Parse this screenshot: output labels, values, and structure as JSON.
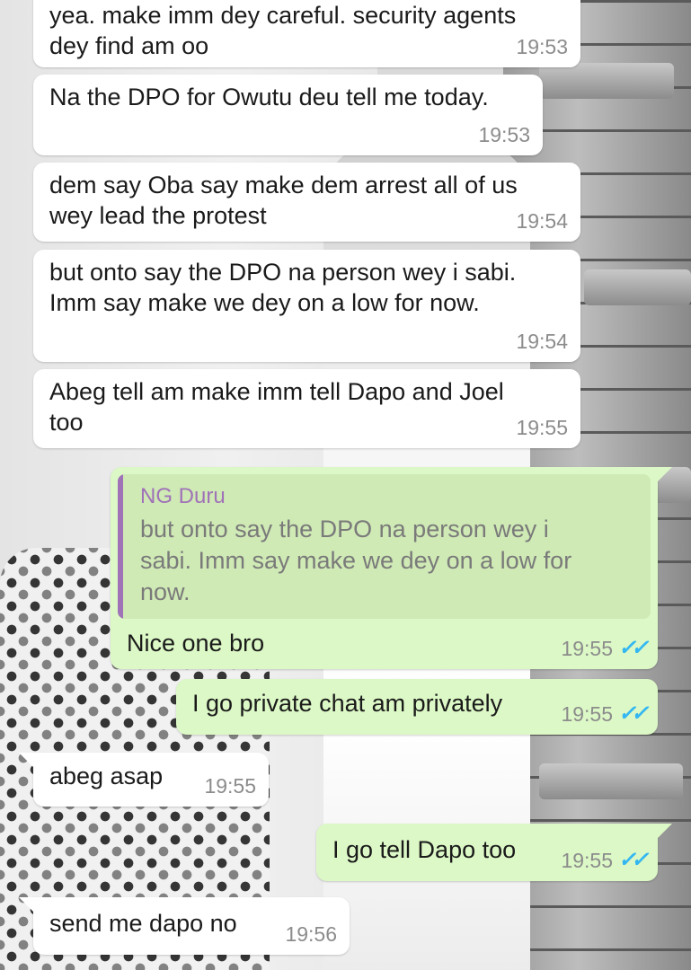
{
  "colors": {
    "incoming_bubble": "#ffffff",
    "outgoing_bubble": "#dcf8c6",
    "quote_background": "#cfeab5",
    "quote_accent": "#a072b8",
    "timestamp": "#8c8c8c",
    "read_ticks": "#34b7f1"
  },
  "messages": [
    {
      "direction": "incoming",
      "text": "yea. make imm dey careful. security agents\ndey find am oo",
      "time": "19:53"
    },
    {
      "direction": "incoming",
      "text": "Na the DPO for Owutu deu tell me today.",
      "time": "19:53"
    },
    {
      "direction": "incoming",
      "text": "dem say Oba say make dem arrest all of us\nwey lead the protest",
      "time": "19:54"
    },
    {
      "direction": "incoming",
      "text": "but onto say the DPO na person wey i sabi.\nImm say make we dey on a low for now.",
      "time": "19:54"
    },
    {
      "direction": "incoming",
      "text": "Abeg tell am make imm tell Dapo and Joel\ntoo",
      "time": "19:55"
    },
    {
      "direction": "outgoing",
      "quote": {
        "author": "NG Duru",
        "text": "but onto say the DPO na person wey i\nsabi. Imm say make we dey on a low for\nnow."
      },
      "text": "Nice one bro",
      "time": "19:55",
      "status_icon": "double-check-read-icon",
      "ticks_glyph": "✓✓"
    },
    {
      "direction": "outgoing",
      "text": "I go private chat am privately",
      "time": "19:55",
      "status_icon": "double-check-read-icon",
      "ticks_glyph": "✓✓"
    },
    {
      "direction": "incoming",
      "text": "abeg asap",
      "time": "19:55"
    },
    {
      "direction": "outgoing",
      "text": "I go tell Dapo too",
      "time": "19:55",
      "status_icon": "double-check-read-icon",
      "ticks_glyph": "✓✓"
    },
    {
      "direction": "incoming",
      "text": "send me dapo no",
      "time": "19:56"
    }
  ]
}
